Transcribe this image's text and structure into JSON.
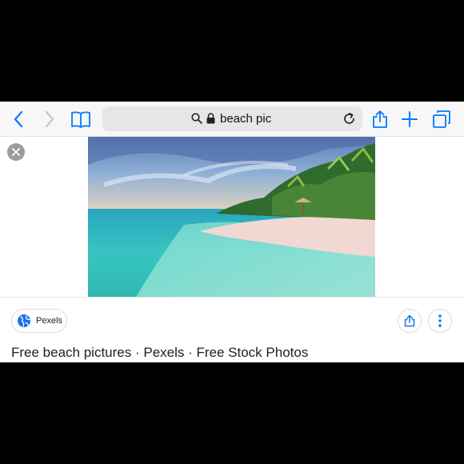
{
  "browser": {
    "url_text": "beach pic",
    "icons": [
      "back-icon",
      "forward-icon",
      "bookmarks-icon",
      "search-icon",
      "lock-icon",
      "reload-icon",
      "share-icon",
      "add-tab-icon",
      "tabs-icon"
    ]
  },
  "result": {
    "image_alt": "beach pic",
    "source_label": "Pexels",
    "title": "Free beach pictures · Pexels · Free Stock Photos"
  },
  "colors": {
    "accent": "#1a73e8",
    "ios_blue": "#007aff",
    "toolbar_bg": "#f7f7f7"
  }
}
